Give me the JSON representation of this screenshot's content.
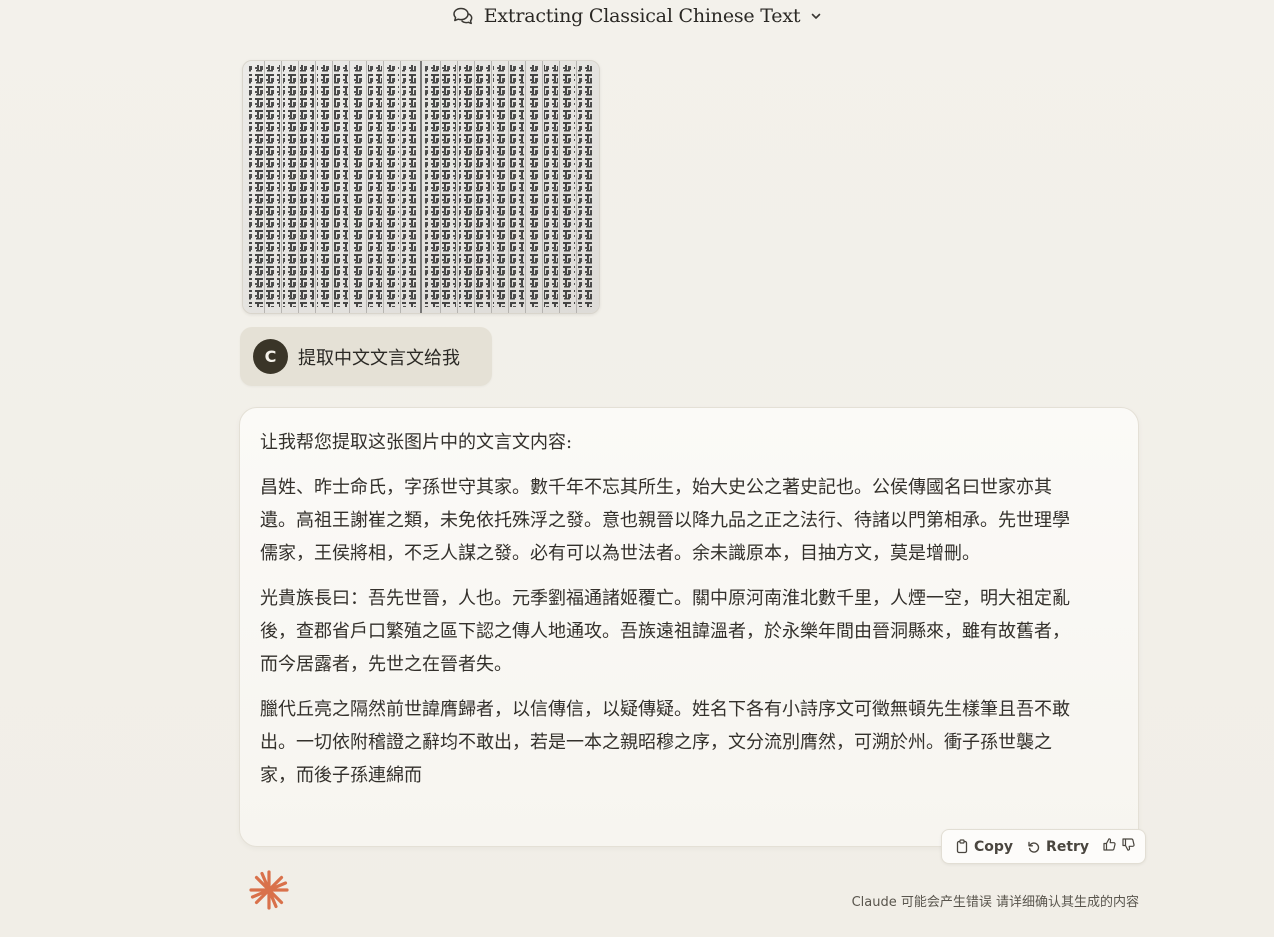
{
  "header": {
    "title": "Extracting Classical Chinese Text",
    "icon": "chat-bubbles-icon",
    "dropdown_icon": "chevron-down-icon"
  },
  "attachment": {
    "description_icon": "image-thumbnail",
    "alt": "古籍文言文图片"
  },
  "user_message": {
    "avatar_initial": "C",
    "text": "提取中文文言文给我"
  },
  "response": {
    "intro": "让我帮您提取这张图片中的文言文内容:",
    "paragraphs": [
      "昌姓、昨士命氏，字孫世守其家。數千年不忘其所生，始大史公之著史記也。公侯傳國名曰世家亦其遺。高祖王謝崔之類，未免依托殊浮之發。意也親晉以降九品之正之法行、待諸以門第相承。先世理學儒家，王侯將相，不乏人謀之發。必有可以為世法者。余未識原本，目抽方文，莫是增刪。",
      "光貴族長曰：吾先世晉，人也。元季劉福通諸姬覆亡。關中原河南淮北數千里，人煙一空，明大祖定亂後，查郡省戶口繁殖之區下認之傳人地通攻。吾族遠祖諱溫者，於永樂年間由晉洞縣來，雖有故舊者，而今居露者，先世之在晉者失。",
      "臘代丘亮之隔然前世諱膺歸者，以信傳信，以疑傳疑。姓名下各有小詩序文可徵無頓先生樣筆且吾不敢出。一切依附稽證之辭均不敢出，若是一本之親昭穆之序，文分流別膺然，可溯於州。衝子孫世襲之家，而後子孫連綿而"
    ]
  },
  "actions": {
    "copy_label": "Copy",
    "retry_label": "Retry"
  },
  "footer": {
    "disclaimer": "Claude 可能会产生错误 请详细确认其生成的内容"
  },
  "colors": {
    "background": "#f2efe8",
    "avatar_bg": "#3a3528",
    "user_bubble": "#e5e1d6",
    "claude_logo": "#d9714b"
  }
}
